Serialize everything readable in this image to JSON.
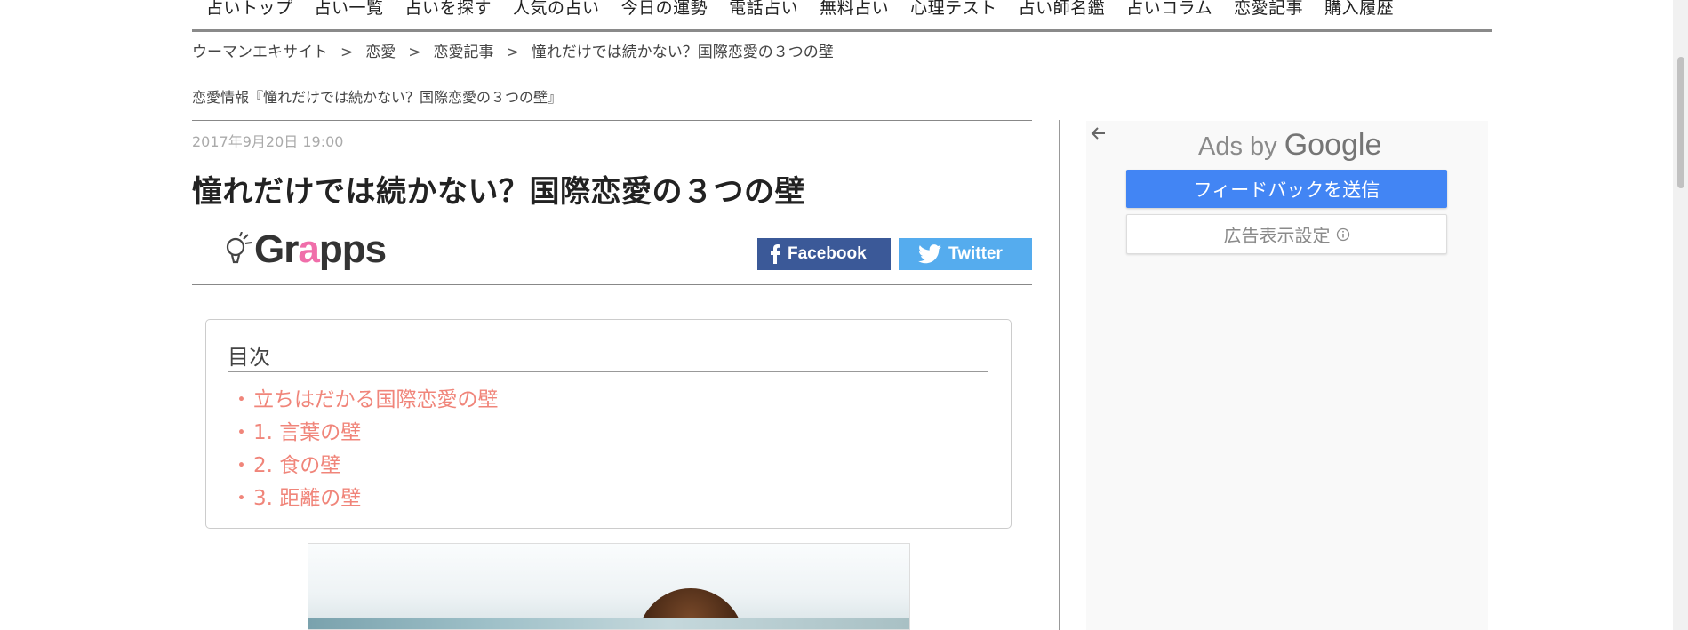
{
  "topnav": {
    "items": [
      "占いトップ",
      "占い一覧",
      "占いを探す",
      "人気の占い",
      "今日の運勢",
      "電話占い",
      "無料占い",
      "心理テスト",
      "占い師名鑑",
      "占いコラム",
      "恋愛記事",
      "購入履歴"
    ]
  },
  "breadcrumb": {
    "items": [
      "ウーマンエキサイト",
      "恋愛",
      "恋愛記事",
      "憧れだけでは続かない？国際恋愛の３つの壁"
    ],
    "separator": ">"
  },
  "category_heading": "恋愛情報『憧れだけでは続かない？国際恋愛の３つの壁』",
  "article": {
    "date": "2017年9月20日 19:00",
    "title": "憧れだけでは続かない？国際恋愛の３つの壁",
    "brand": {
      "prefix": "Gr",
      "highlight": "a",
      "suffix": "pps",
      "highlight_color": "#f06eaa"
    }
  },
  "share": {
    "facebook_label": "Facebook",
    "twitter_label": "Twitter",
    "facebook_color": "#3b5998",
    "twitter_color": "#55acee"
  },
  "toc": {
    "title": "目次",
    "items": [
      "立ちはだかる国際恋愛の壁",
      "1. 言葉の壁",
      "2. 食の壁",
      "3. 距離の壁"
    ],
    "bullet": "・",
    "link_color": "#f0857a"
  },
  "ads": {
    "ads_by": "Ads by",
    "google": "Google",
    "feedback_label": "フィードバックを送信",
    "settings_label": "広告表示設定",
    "accent": "#4285f4"
  },
  "icons": [
    "arrow-left-icon",
    "facebook-icon",
    "twitter-icon",
    "info-icon",
    "lightbulb-logo-icon"
  ]
}
